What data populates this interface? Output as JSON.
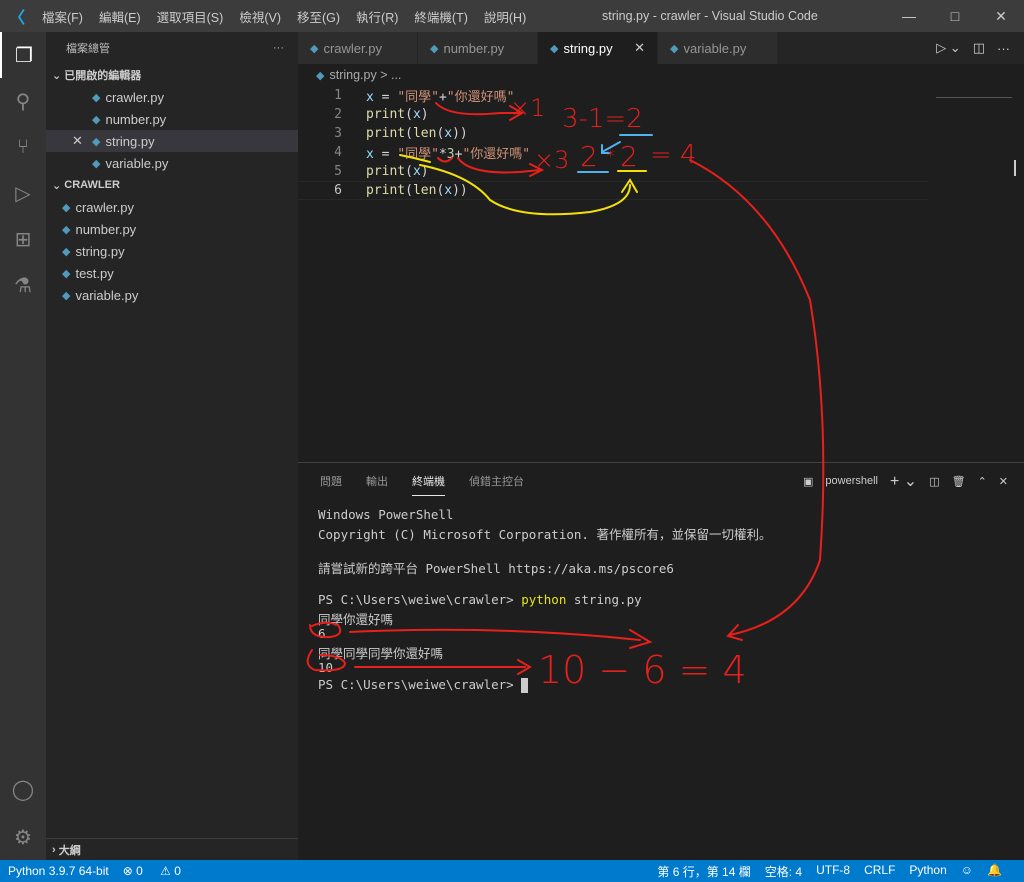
{
  "window": {
    "title": "string.py - crawler - Visual Studio Code",
    "menu": [
      "檔案(F)",
      "編輯(E)",
      "選取項目(S)",
      "檢視(V)",
      "移至(G)",
      "執行(R)",
      "終端機(T)",
      "說明(H)"
    ]
  },
  "sidebar": {
    "title": "檔案總管",
    "more": "···",
    "open_editors_label": "已開啟的編輯器",
    "open_editors": [
      "crawler.py",
      "number.py",
      "string.py",
      "variable.py"
    ],
    "folder_label": "CRAWLER",
    "files": [
      "crawler.py",
      "number.py",
      "string.py",
      "test.py",
      "variable.py"
    ],
    "outline_label": "大綱"
  },
  "tabs": [
    {
      "label": "crawler.py"
    },
    {
      "label": "number.py"
    },
    {
      "label": "string.py",
      "active": true
    },
    {
      "label": "variable.py"
    }
  ],
  "breadcrumb": {
    "file": "string.py",
    "rest": "> ..."
  },
  "code": [
    {
      "n": "1",
      "parts": [
        [
          "var",
          "x"
        ],
        [
          "op",
          " = "
        ],
        [
          "str",
          "\"同學\""
        ],
        [
          "op",
          "+"
        ],
        [
          "str",
          "\"你還好嗎\""
        ]
      ]
    },
    {
      "n": "2",
      "parts": [
        [
          "kw",
          "print"
        ],
        [
          "op",
          "("
        ],
        [
          "var",
          "x"
        ],
        [
          "op",
          ")"
        ]
      ]
    },
    {
      "n": "3",
      "parts": [
        [
          "kw",
          "print"
        ],
        [
          "op",
          "("
        ],
        [
          "kw",
          "len"
        ],
        [
          "op",
          "("
        ],
        [
          "var",
          "x"
        ],
        [
          "op",
          "))"
        ]
      ]
    },
    {
      "n": "4",
      "parts": [
        [
          "var",
          "x"
        ],
        [
          "op",
          " = "
        ],
        [
          "str",
          "\"同學\""
        ],
        [
          "op",
          "*"
        ],
        [
          "num",
          "3"
        ],
        [
          "op",
          "+"
        ],
        [
          "str",
          "\"你還好嗎\""
        ]
      ]
    },
    {
      "n": "5",
      "parts": [
        [
          "kw",
          "print"
        ],
        [
          "op",
          "("
        ],
        [
          "var",
          "x"
        ],
        [
          "op",
          ")"
        ]
      ]
    },
    {
      "n": "6",
      "parts": [
        [
          "kw",
          "print"
        ],
        [
          "op",
          "("
        ],
        [
          "kw",
          "len"
        ],
        [
          "op",
          "("
        ],
        [
          "var",
          "x"
        ],
        [
          "op",
          "))"
        ]
      ]
    }
  ],
  "panel": {
    "tabs": [
      "問題",
      "輸出",
      "終端機",
      "偵錯主控台"
    ],
    "active_tab": "終端機",
    "shell": "powershell"
  },
  "terminal": {
    "lines": [
      "Windows PowerShell",
      "Copyright (C) Microsoft Corporation. 著作權所有，並保留一切權利。",
      "",
      "請嘗試新的跨平台 PowerShell https://aka.ms/pscore6",
      ""
    ],
    "prompt": "PS C:\\Users\\weiwe\\crawler> ",
    "command": "python",
    "args": " string.py",
    "output": [
      "同學你還好嗎",
      "6",
      "同學同學同學你還好嗎",
      "10"
    ]
  },
  "status": {
    "interpreter": "Python 3.9.7 64-bit",
    "errors": "0",
    "warnings": "0",
    "position": "第 6 行，第 14 欄",
    "spaces": "空格: 4",
    "encoding": "UTF-8",
    "eol": "CRLF",
    "language": "Python"
  },
  "annotations": {
    "a1": "×1",
    "a2": "3-1=2",
    "a3": "×3",
    "a4": "2",
    "a5": "*",
    "a6": "2",
    "a7": "= 4",
    "a8": "10 − 6 = 4"
  },
  "colors": {
    "accent": "#007acc",
    "annotation_red": "#e8201c",
    "annotation_yellow": "#f5e10a",
    "annotation_blue": "#4fb3f0"
  }
}
